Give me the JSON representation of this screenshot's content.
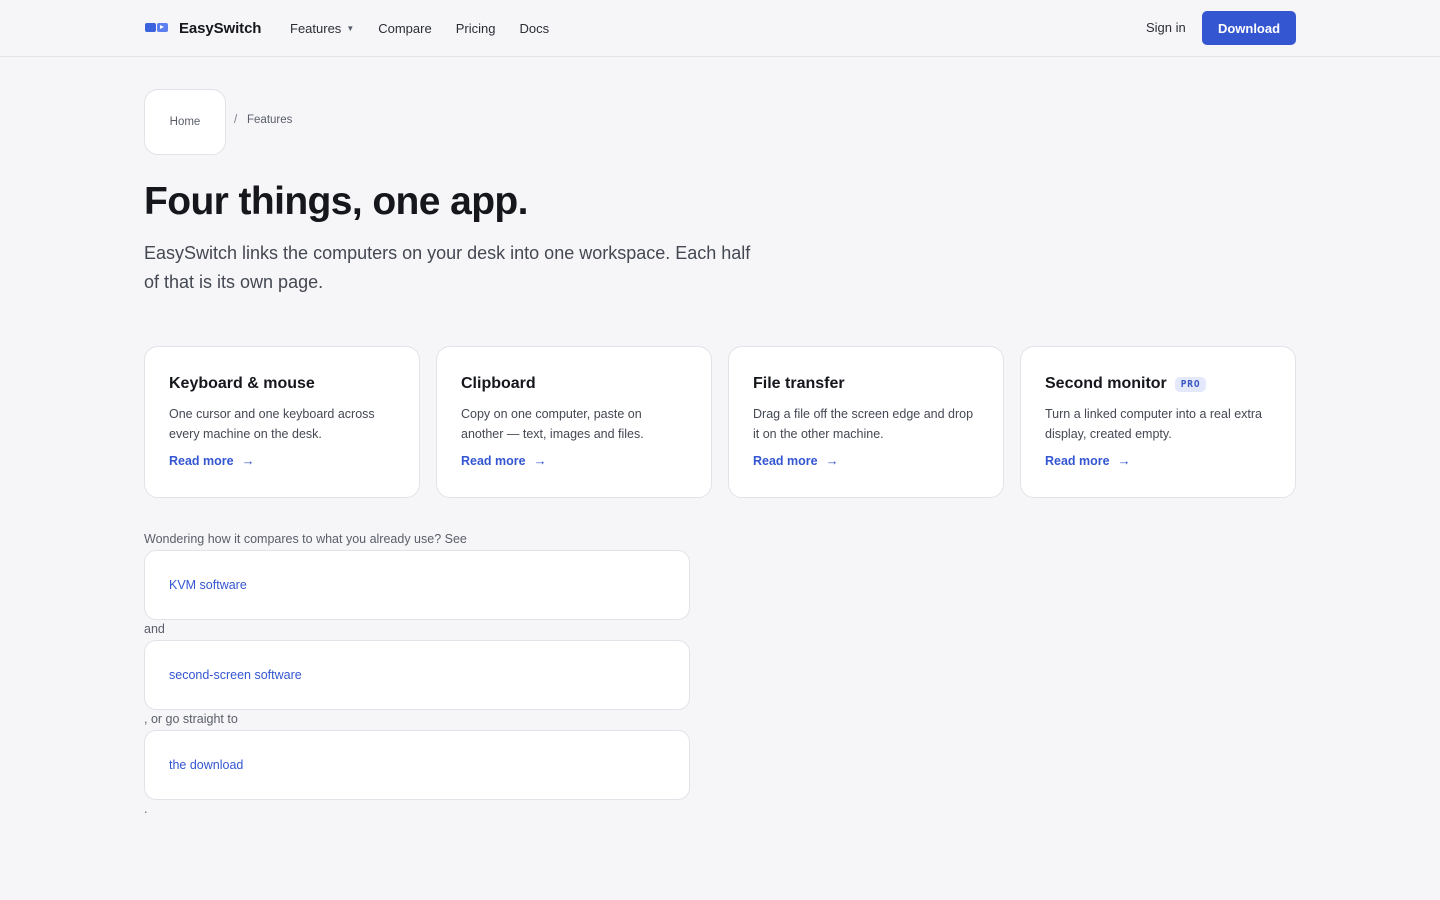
{
  "header": {
    "brand": "EasySwitch",
    "nav": [
      {
        "label": "Features",
        "has_menu": true
      },
      {
        "label": "Compare"
      },
      {
        "label": "Pricing"
      },
      {
        "label": "Docs"
      }
    ],
    "signin_label": "Sign in",
    "download_label": "Download",
    "accent_color": "#3456d1"
  },
  "breadcrumb": {
    "home": "Home",
    "separator": "/",
    "current": "Features"
  },
  "hero": {
    "title": "Four things, one app.",
    "subtitle": "EasySwitch links the computers on your desk into one workspace. Each half of that is its own page."
  },
  "features": [
    {
      "title": "Keyboard & mouse",
      "description": "One cursor and one keyboard across every machine on the desk.",
      "link": "Read more",
      "badge": ""
    },
    {
      "title": "Clipboard",
      "description": "Copy on one computer, paste on another — text, images and files.",
      "link": "Read more",
      "badge": ""
    },
    {
      "title": "File transfer",
      "description": "Drag a file off the screen edge and drop it on the other machine.",
      "link": "Read more",
      "badge": ""
    },
    {
      "title": "Second monitor",
      "description": "Turn a linked computer into a real extra display, created empty.",
      "link": "Read more",
      "badge": "PRO"
    }
  ],
  "compare": {
    "intro": "Wondering how it compares to what you already use? See",
    "link_kvm": "KVM software",
    "and": "and",
    "link_second_screen": "second-screen software",
    "or": ", or go straight to",
    "link_download": "the download",
    "end": "."
  }
}
